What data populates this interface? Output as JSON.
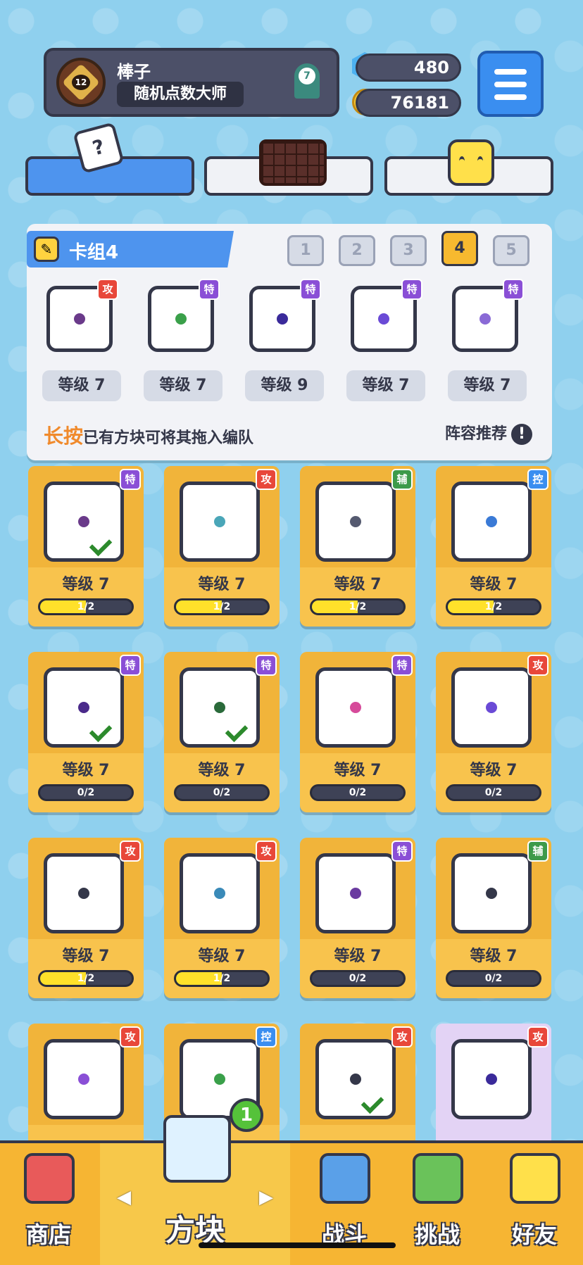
{
  "profile": {
    "name": "棒子",
    "title": "随机点数大师",
    "level": "12",
    "rank": "7"
  },
  "resources": {
    "gems": "480",
    "coins": "76181"
  },
  "colors": {
    "attack": "#e8473a",
    "special": "#8a4fd6",
    "support": "#3d9a4a",
    "control": "#3a8ef0"
  },
  "deck": {
    "title": "卡组4",
    "slots": [
      "1",
      "2",
      "3",
      "4",
      "5"
    ],
    "active_slot": "4",
    "cards": [
      {
        "type": "攻",
        "level": "等级 7",
        "pip": "#6a3a8a"
      },
      {
        "type": "特",
        "level": "等级 7",
        "pip": "#3aa04a"
      },
      {
        "type": "特",
        "level": "等级 9",
        "pip": "#3a2a9a"
      },
      {
        "type": "特",
        "level": "等级 7",
        "pip": "#6a4ad6"
      },
      {
        "type": "特",
        "level": "等级 7",
        "pip": "#8a6ad6"
      }
    ],
    "hint_emphasis": "长按",
    "hint_rest": "已有方块可将其拖入编队",
    "recommend": "阵容推荐",
    "recommend_icon": "!"
  },
  "collection": [
    {
      "type": "特",
      "level": "等级 7",
      "progress": "1/2",
      "fill": 0.5,
      "check": true,
      "pip": "#6a3a8a"
    },
    {
      "type": "攻",
      "level": "等级 7",
      "progress": "1/2",
      "fill": 0.5,
      "check": false,
      "pip": "#4aa6b8"
    },
    {
      "type": "辅",
      "level": "等级 7",
      "progress": "1/2",
      "fill": 0.5,
      "check": false,
      "pip": "#555a70"
    },
    {
      "type": "控",
      "level": "等级 7",
      "progress": "1/2",
      "fill": 0.5,
      "check": false,
      "pip": "#3a7ad6"
    },
    {
      "type": "特",
      "level": "等级 7",
      "progress": "0/2",
      "fill": 0,
      "check": true,
      "pip": "#4a2a8a"
    },
    {
      "type": "特",
      "level": "等级 7",
      "progress": "0/2",
      "fill": 0,
      "check": true,
      "pip": "#2a6a3a"
    },
    {
      "type": "特",
      "level": "等级 7",
      "progress": "0/2",
      "fill": 0,
      "check": false,
      "pip": "#d64a9a"
    },
    {
      "type": "攻",
      "level": "等级 7",
      "progress": "0/2",
      "fill": 0,
      "check": false,
      "pip": "#6a4ad6"
    },
    {
      "type": "攻",
      "level": "等级 7",
      "progress": "1/2",
      "fill": 0.5,
      "check": false,
      "pip": "#343749"
    },
    {
      "type": "攻",
      "level": "等级 7",
      "progress": "1/2",
      "fill": 0.5,
      "check": false,
      "pip": "#3a8ab8"
    },
    {
      "type": "特",
      "level": "等级 7",
      "progress": "0/2",
      "fill": 0,
      "check": false,
      "pip": "#6a3aa0"
    },
    {
      "type": "辅",
      "level": "等级 7",
      "progress": "0/2",
      "fill": 0,
      "check": false,
      "pip": "#343749"
    },
    {
      "type": "攻",
      "level": "",
      "progress": "",
      "fill": 0,
      "check": false,
      "pip": "#8a4fd6"
    },
    {
      "type": "控",
      "level": "",
      "progress": "",
      "fill": 0,
      "check": false,
      "pip": "#3aa04a"
    },
    {
      "type": "攻",
      "level": "",
      "progress": "",
      "fill": 0,
      "check": true,
      "pip": "#343749"
    },
    {
      "type": "攻",
      "level": "",
      "progress": "",
      "fill": 0,
      "check": false,
      "pip": "#3a2a9a",
      "purple": true
    }
  ],
  "nav": {
    "shop": "商店",
    "blocks": "方块",
    "battle": "战斗",
    "challenge": "挑战",
    "friends": "好友",
    "badge": "1"
  }
}
